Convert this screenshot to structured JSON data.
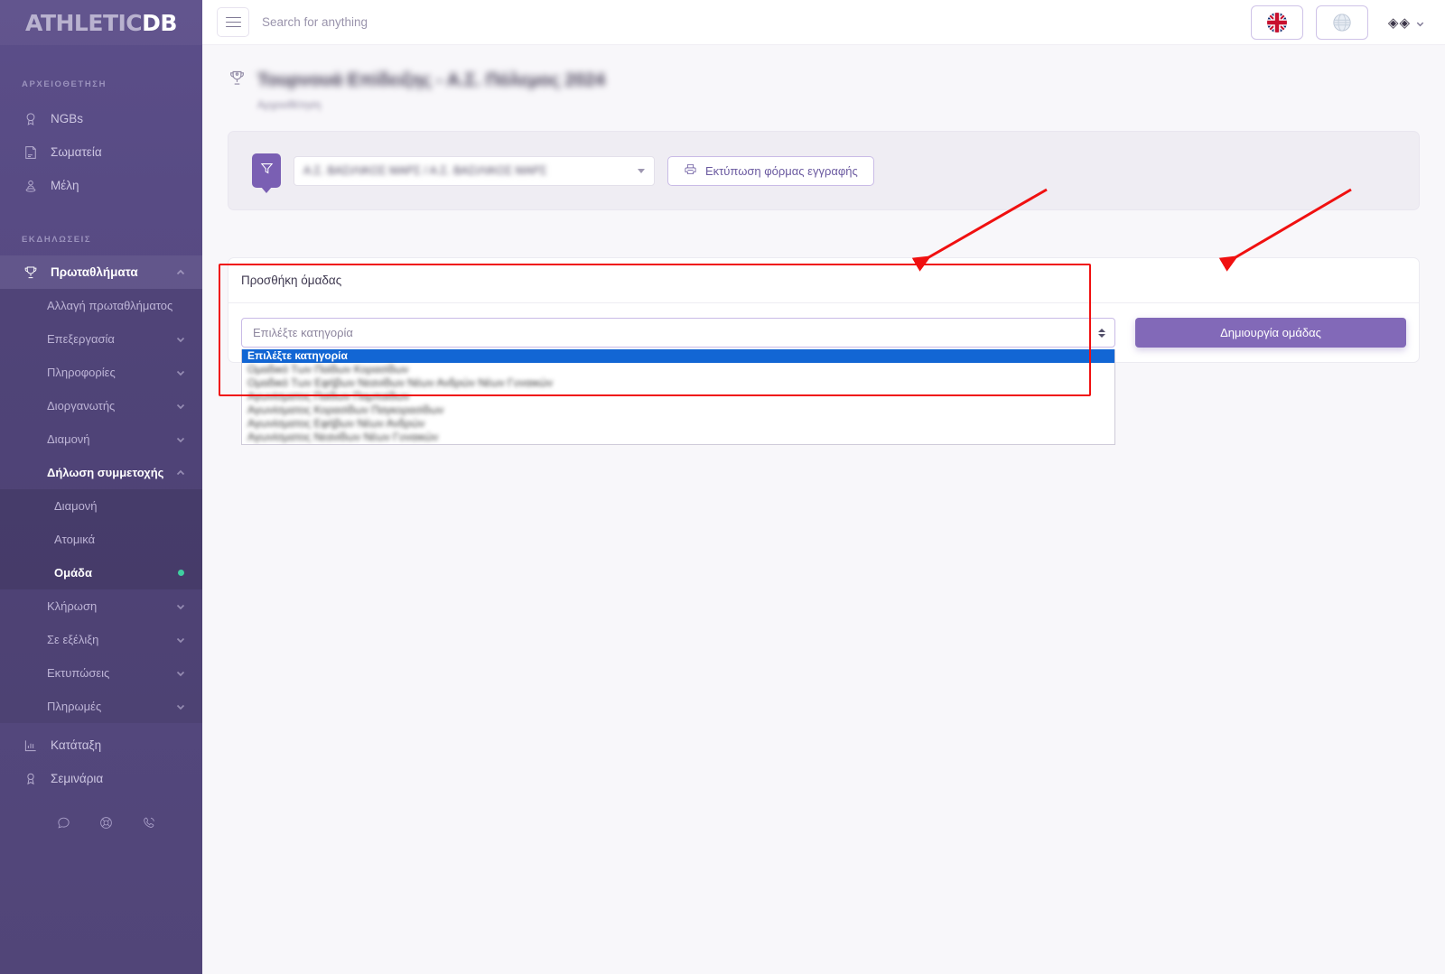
{
  "brand": {
    "part1": "ATHLETIC",
    "part2": "DB"
  },
  "topbar": {
    "menu_icon": "hamburger-icon",
    "search_placeholder": "Search for anything",
    "search_value": "",
    "language_icon": "uk-flag-icon",
    "globe_icon": "globe-icon",
    "user_label": "◈◈",
    "caret_icon": "chevron-down-icon"
  },
  "sidebar": {
    "sections": [
      {
        "title": "ΑΡΧΕΙΟΘΕΤΗΣΗ"
      },
      {
        "title": "ΕΚΔΗΛΩΣΕΙΣ"
      }
    ],
    "archive_items": [
      {
        "label": "NGBs",
        "icon": "medal-icon"
      },
      {
        "label": "Σωματεία",
        "icon": "building-icon"
      },
      {
        "label": "Μέλη",
        "icon": "member-pin-icon"
      }
    ],
    "championships": {
      "label": "Πρωταθλήματα",
      "icon": "trophy-icon"
    },
    "championship_items": [
      {
        "label": "Αλλαγή πρωταθλήματος",
        "expandable": false
      },
      {
        "label": "Επεξεργασία",
        "expandable": true
      },
      {
        "label": "Πληροφορίες",
        "expandable": true
      },
      {
        "label": "Διοργανωτής",
        "expandable": true
      },
      {
        "label": "Διαμονή",
        "expandable": true
      }
    ],
    "participation": {
      "label": "Δήλωση συμμετοχής"
    },
    "participation_items": [
      {
        "label": "Διαμονή",
        "current": false
      },
      {
        "label": "Ατομικά",
        "current": false
      },
      {
        "label": "Ομάδα",
        "current": true
      }
    ],
    "championship_items_tail": [
      {
        "label": "Κλήρωση",
        "expandable": true
      },
      {
        "label": "Σε εξέλιξη",
        "expandable": true
      },
      {
        "label": "Εκτυπώσεις",
        "expandable": true
      },
      {
        "label": "Πληρωμές",
        "expandable": true
      }
    ],
    "bottom_items": [
      {
        "label": "Κατάταξη",
        "icon": "chart-bars-icon"
      },
      {
        "label": "Σεμινάρια",
        "icon": "award-person-icon"
      }
    ],
    "footer_icons": [
      "chat-icon",
      "lifebuoy-icon",
      "phone-icon"
    ]
  },
  "page": {
    "title": "Τουρνουά Επίδειξης - Α.Σ. Πόλεμος 2024",
    "subtitle": "Αρχειοθέτηση",
    "trophy_icon": "trophy-icon"
  },
  "filter_bar": {
    "funnel_icon": "funnel-icon",
    "club_value": "Α.Σ. ΒΑΣΙΛΙΚΟΣ ΜΑΡΣ / Α.Σ. ΒΑΣΙΛΙΚΟΣ ΜΑΡΣ",
    "print_label": "Εκτύπωση φόρμας εγγραφής",
    "print_icon": "printer-icon"
  },
  "team_card": {
    "heading": "Προσθήκη όμαδας",
    "select_value": "Επιλέξτε κατηγορία",
    "create_label": "Δημιουργία ομάδας",
    "options": [
      {
        "label": "Επιλέξτε κατηγορία",
        "selected": true
      },
      {
        "label": "Ομαδικό Των Παίδων Κορασίδων",
        "selected": false
      },
      {
        "label": "Ομαδικό Των Εφήβων Νεανίδων Νέων Ανδρών Νέων Γυναικών",
        "selected": false
      },
      {
        "label": "Αγωνίσματος Παίδων Παμπαίδων",
        "selected": false
      },
      {
        "label": "Αγωνίσματος Κορασίδων Παγκορασίδων",
        "selected": false
      },
      {
        "label": "Αγωνίσματος Εφήβων Νέων Ανδρών",
        "selected": false
      },
      {
        "label": "Αγωνίσματος Νεανίδων Νέων Γυναικών",
        "selected": false
      }
    ]
  },
  "annotations": {
    "box_color": "#f01010",
    "arrow_color": "#f01010",
    "boxes": 1,
    "arrows": 2
  }
}
